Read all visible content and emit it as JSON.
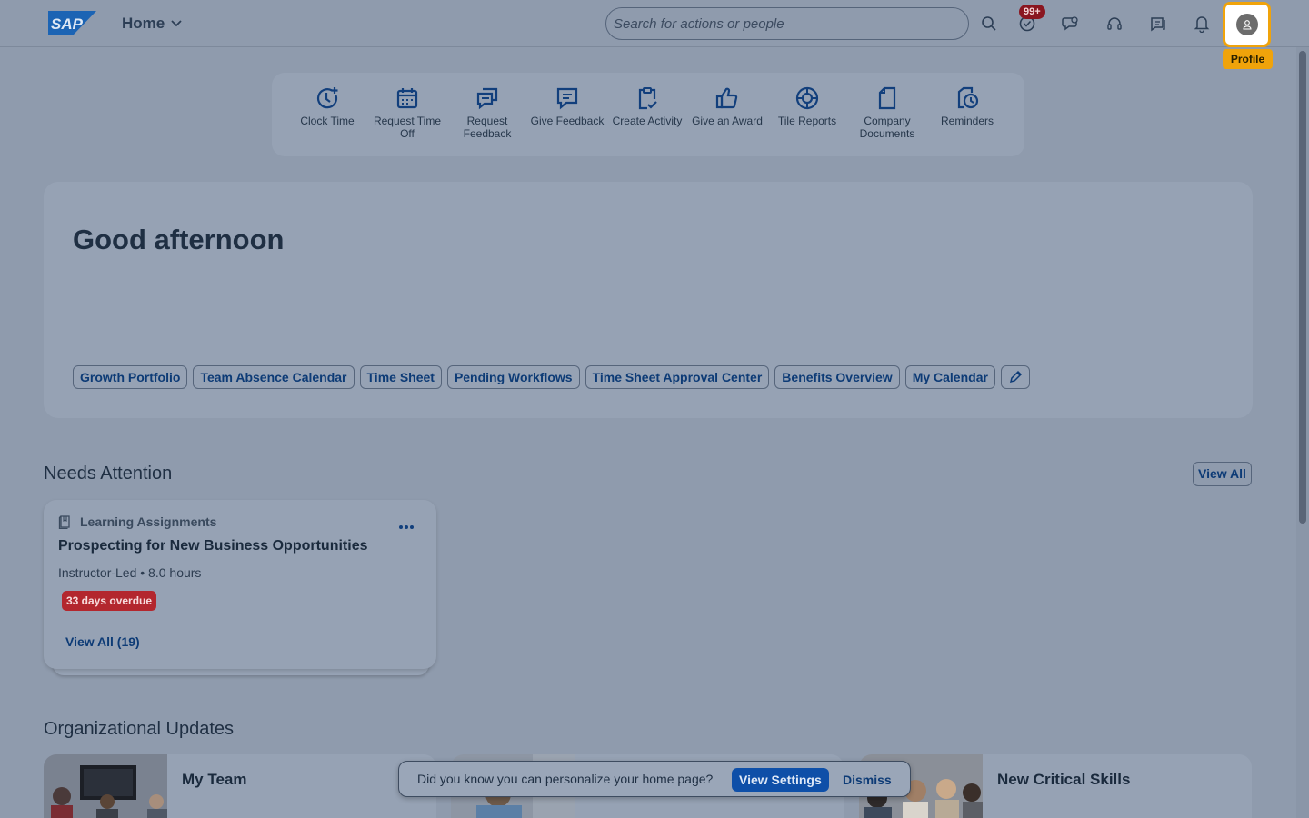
{
  "header": {
    "logo_text": "SAP",
    "home_label": "Home",
    "search_placeholder": "Search for actions or people",
    "notification_badge": "99+",
    "profile_tooltip": "Profile"
  },
  "quick_actions": [
    {
      "label": "Clock Time",
      "icon": "clock-plus-icon"
    },
    {
      "label": "Request Time Off",
      "icon": "calendar-icon"
    },
    {
      "label": "Request Feedback",
      "icon": "feedback-request-icon"
    },
    {
      "label": "Give Feedback",
      "icon": "comment-icon"
    },
    {
      "label": "Create Activity",
      "icon": "clipboard-check-icon"
    },
    {
      "label": "Give an Award",
      "icon": "thumbs-up-icon"
    },
    {
      "label": "Tile Reports",
      "icon": "target-icon"
    },
    {
      "label": "Company Documents",
      "icon": "document-icon"
    },
    {
      "label": "Reminders",
      "icon": "reminder-icon"
    }
  ],
  "greeting": {
    "title": "Good afternoon",
    "links": [
      "Growth Portfolio",
      "Team Absence Calendar",
      "Time Sheet",
      "Pending Workflows",
      "Time Sheet Approval Center",
      "Benefits Overview",
      "My Calendar"
    ]
  },
  "needs_attention": {
    "title": "Needs Attention",
    "view_all": "View All",
    "card": {
      "type": "Learning Assignments",
      "title": "Prospecting for New Business Opportunities",
      "meta": "Instructor-Led • 8.0 hours",
      "status": "33 days overdue",
      "link": "View All (19)"
    }
  },
  "org_updates": {
    "title": "Organizational Updates",
    "cards": [
      {
        "title": "My Team"
      },
      {
        "title": ""
      },
      {
        "title": "New Critical Skills"
      }
    ]
  },
  "toast": {
    "text": "Did you know you can personalize your home page?",
    "primary": "View Settings",
    "dismiss": "Dismiss"
  }
}
